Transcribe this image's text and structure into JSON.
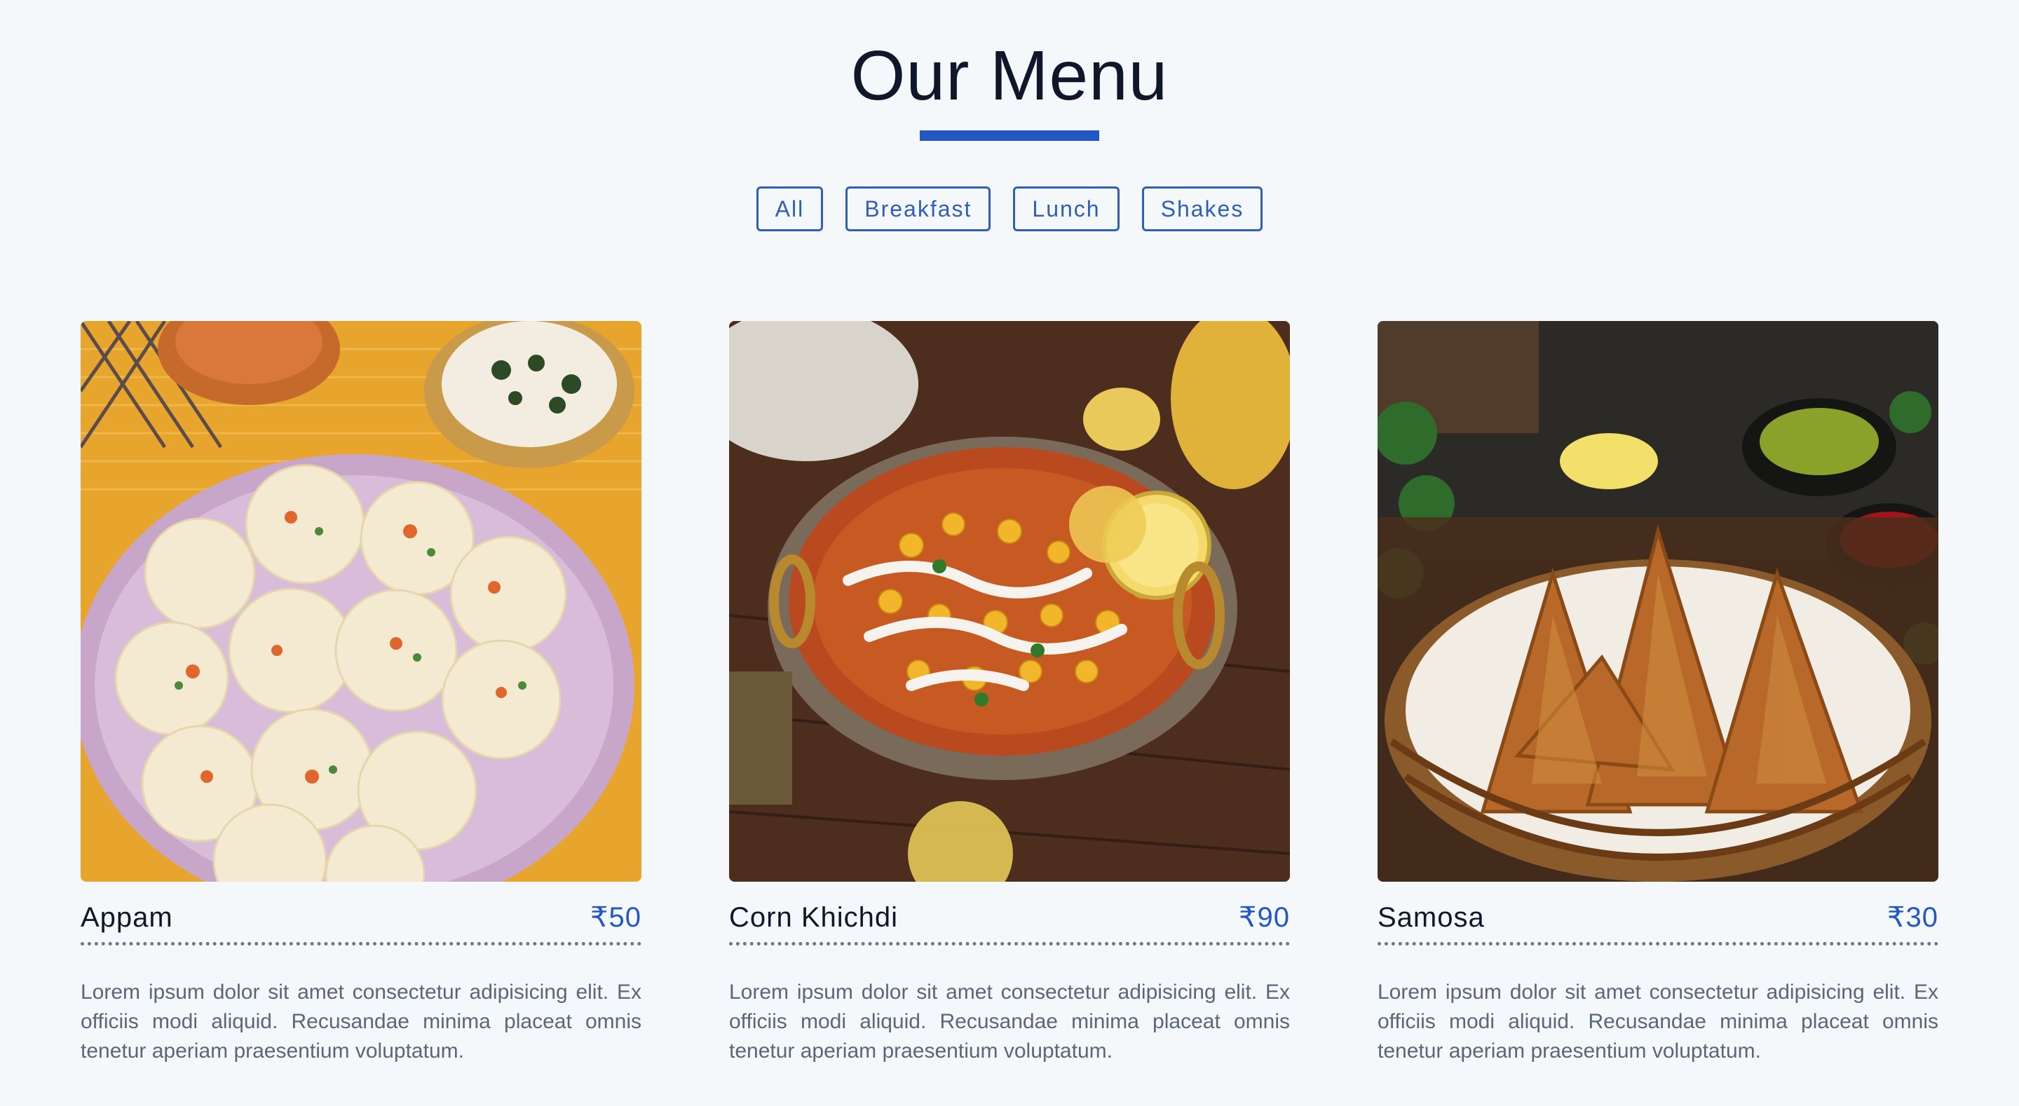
{
  "header": {
    "title": "Our Menu"
  },
  "filters": [
    "All",
    "Breakfast",
    "Lunch",
    "Shakes"
  ],
  "menu": [
    {
      "name": "Appam",
      "price": "₹50",
      "image_icon": "appam-plate-image",
      "description": "Lorem ipsum dolor sit amet consectetur adipisicing elit. Ex officiis modi aliquid. Recusandae minima placeat omnis tenetur aperiam praesentium voluptatum."
    },
    {
      "name": "Corn Khichdi",
      "price": "₹90",
      "image_icon": "corn-khichdi-bowl-image",
      "description": "Lorem ipsum dolor sit amet consectetur adipisicing elit. Ex officiis modi aliquid. Recusandae minima placeat omnis tenetur aperiam praesentium voluptatum."
    },
    {
      "name": "Samosa",
      "price": "₹30",
      "image_icon": "samosa-basket-image",
      "description": "Lorem ipsum dolor sit amet consectetur adipisicing elit. Ex officiis modi aliquid. Recusandae minima placeat omnis tenetur aperiam praesentium voluptatum."
    }
  ],
  "colors": {
    "accent": "#2257c4",
    "background": "#f5f8fb",
    "heading": "#10172b",
    "text_muted": "#5b6676"
  }
}
